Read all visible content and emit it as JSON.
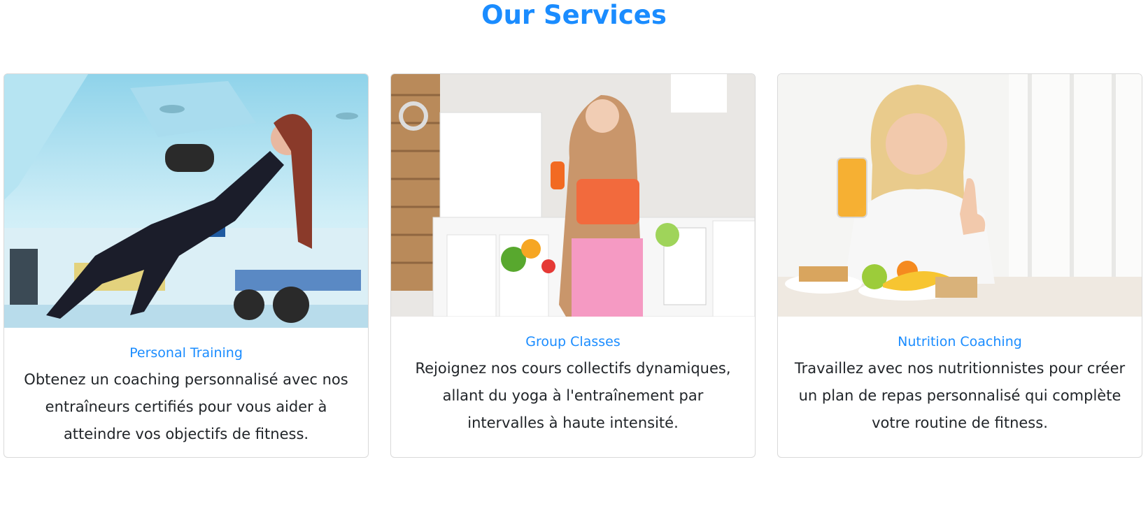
{
  "section": {
    "title": "Our Services"
  },
  "services": [
    {
      "title": "Personal Training",
      "text": "Obtenez un coaching personnalisé avec nos entraîneurs certifiés pour vous aider à atteindre vos objectifs de fitness.",
      "image": "woman-dumbbell-plank-gym-photo"
    },
    {
      "title": "Group Classes",
      "text": "Rejoignez nos cours collectifs dynamiques, allant du yoga à l'entraînement par intervalles à haute intensité.",
      "image": "woman-kitchen-dumbbell-apple-photo"
    },
    {
      "title": "Nutrition Coaching",
      "text": "Travaillez avec nos nutritionnistes pour créer un plan de repas personnalisé qui complète votre routine de fitness.",
      "image": "woman-juice-thumbs-up-photo"
    }
  ],
  "colors": {
    "accent": "#1a8cff",
    "text": "#212529",
    "border": "#d9d9d9"
  }
}
